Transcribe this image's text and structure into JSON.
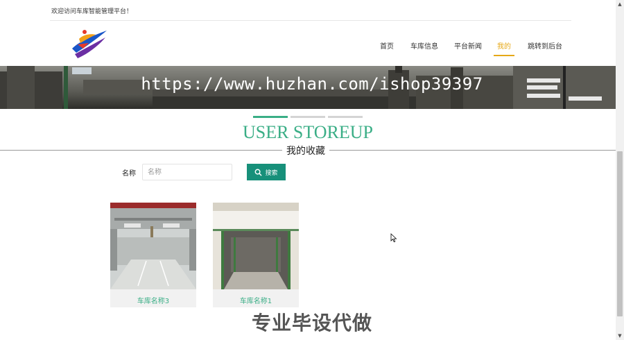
{
  "topbar": {
    "welcome": "欢迎访问车库智能管理平台！"
  },
  "nav": {
    "items": [
      {
        "label": "首页",
        "active": false
      },
      {
        "label": "车库信息",
        "active": false
      },
      {
        "label": "平台新闻",
        "active": false
      },
      {
        "label": "我的",
        "active": true
      },
      {
        "label": "跳转到后台",
        "active": false
      }
    ]
  },
  "banner": {
    "overlay_text": "https://www.huzhan.com/ishop39397"
  },
  "section": {
    "title": "USER STOREUP",
    "subtitle": "我的收藏"
  },
  "search": {
    "label": "名称",
    "placeholder": "名称",
    "value": "",
    "button_label": "搜索"
  },
  "items": [
    {
      "name": "车库名称3"
    },
    {
      "name": "车库名称1"
    }
  ],
  "watermark": "专业毕设代做",
  "colors": {
    "accent": "#3aae86",
    "button": "#17907a",
    "nav_active": "#e6a817"
  }
}
